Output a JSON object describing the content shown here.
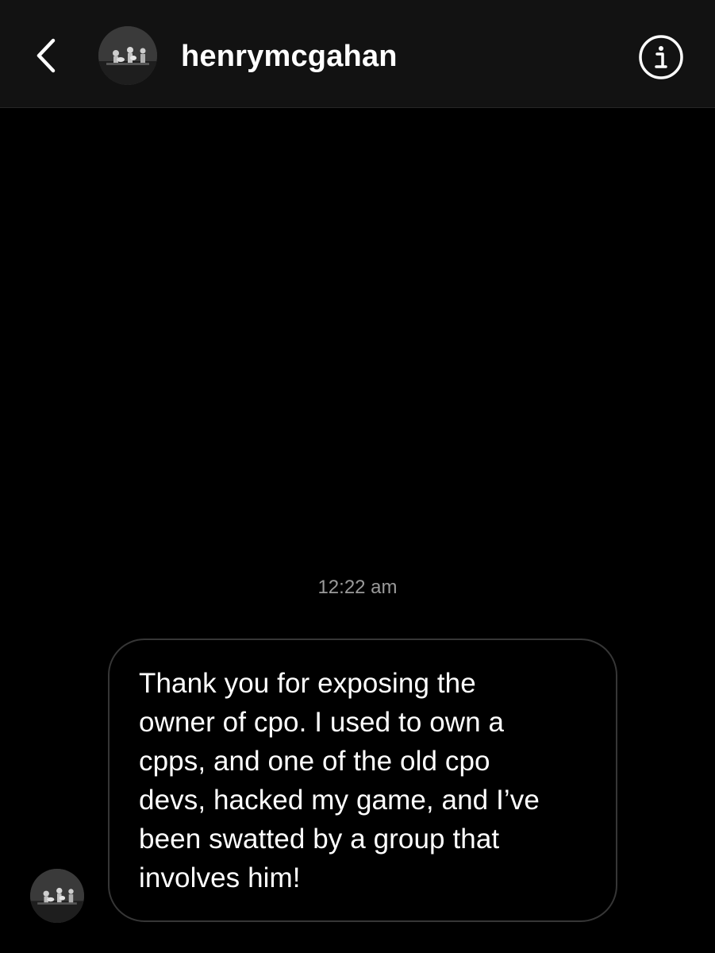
{
  "header": {
    "back_icon": "chevron-left-icon",
    "avatar": "profile-photo-bw-concert",
    "username": "henrymcgahan",
    "info_icon": "info-circle-icon"
  },
  "thread": {
    "timestamp": "12:22 am",
    "messages": [
      {
        "sender_avatar": "profile-photo-bw-concert",
        "text": "Thank you for exposing the\nowner of cpo. I used to own a\ncpps, and one of the old cpo\ndevs, hacked my game, and I’ve\nbeen swatted by a group that\ninvolves him!"
      }
    ]
  },
  "colors": {
    "background": "#000000",
    "header_bg": "#121212",
    "text": "#ffffff",
    "timestamp": "#9a9a9a",
    "bubble_border": "#363636"
  }
}
